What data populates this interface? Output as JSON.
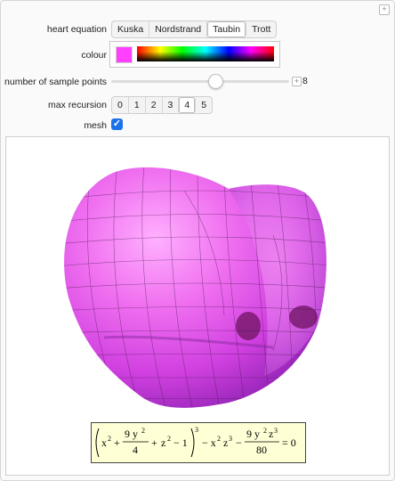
{
  "controls": {
    "heart_equation": {
      "label": "heart equation",
      "options": [
        "Kuska",
        "Nordstrand",
        "Taubin",
        "Trott"
      ],
      "selected": "Taubin"
    },
    "colour": {
      "label": "colour",
      "value": "#ff40ff"
    },
    "sample_points": {
      "label": "number of sample points",
      "value": "8",
      "fraction": 0.58
    },
    "max_recursion": {
      "label": "max recursion",
      "options": [
        "0",
        "1",
        "2",
        "3",
        "4",
        "5"
      ],
      "selected": "4"
    },
    "mesh": {
      "label": "mesh",
      "checked": true
    }
  },
  "plot": {
    "surface_color": "#e45ce8"
  },
  "formula": {
    "text": "(x² + 9y²/4 + z² − 1)³ − x² z³ − 9y² z³/80 = 0",
    "t_x2": "x",
    "t_sup2a": "2",
    "t_plus1": "+",
    "t_9y2": "9 y",
    "t_sup2b": "2",
    "t_4": "4",
    "t_plus2": "+",
    "t_z": "z",
    "t_sup2c": "2",
    "t_minus1": "− 1",
    "t_cube": "3",
    "t_term2": "− x",
    "t_sup2d": "2",
    "t_z3a": "z",
    "t_sup3a": "3",
    "t_minus2": "−",
    "t_9y2b": "9 y",
    "t_sup2e": "2",
    "t_z3b": "z",
    "t_sup3b": "3",
    "t_80": "80",
    "t_eq": "= 0"
  }
}
